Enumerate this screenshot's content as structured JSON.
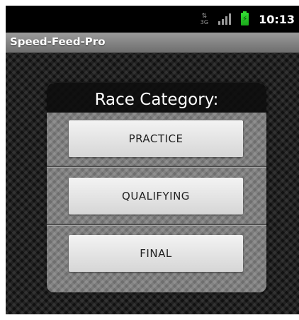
{
  "status_bar": {
    "network_label": "3G",
    "time": "10:13",
    "battery_color": "#33dd33"
  },
  "app": {
    "title": "Speed-Feed-Pro"
  },
  "dialog": {
    "title": "Race Category:",
    "options": [
      {
        "label": "PRACTICE"
      },
      {
        "label": "QUALIFYING"
      },
      {
        "label": "FINAL"
      }
    ]
  },
  "icons": [
    "network-3g-icon",
    "signal-strength-icon",
    "battery-charging-icon"
  ]
}
